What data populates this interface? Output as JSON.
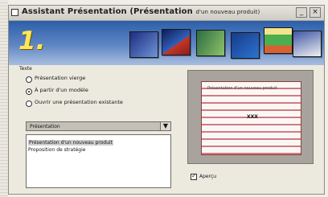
{
  "window": {
    "title_main": "Assistant Présentation (Présentation",
    "title_tail": "d'un nouveau produit)",
    "minimize": "_",
    "close": "×"
  },
  "banner": {
    "step_number": "1."
  },
  "content_options": {
    "label": "Texte",
    "options": [
      {
        "label": "Présentation vierge",
        "selected": false
      },
      {
        "label": "À partir d'un modèle",
        "selected": true
      },
      {
        "label": "Ouvrir une présentation existante",
        "selected": false
      }
    ]
  },
  "template": {
    "selected_value": "Présentation",
    "items": [
      "Présentation d'un nouveau produit",
      "Proposition de stratégie"
    ]
  },
  "preview": {
    "slide_title": "Présentation d'un nouveau produit",
    "slide_subtitle": "XXX"
  },
  "options": {
    "show_label": "Aperçu",
    "checked": true
  }
}
